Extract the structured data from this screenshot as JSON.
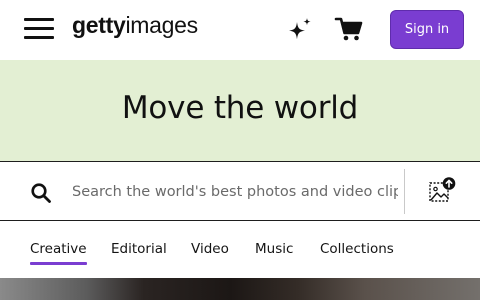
{
  "header": {
    "logo_bold": "getty",
    "logo_light": "images",
    "menu_icon": "hamburger-menu-icon",
    "ai_icon": "sparkle-icon",
    "cart_icon": "shopping-cart-icon",
    "sign_in_label": "Sign in",
    "accent_color": "#7a3dd1"
  },
  "hero": {
    "title": "Move the world",
    "background_color": "#e3efd3"
  },
  "search": {
    "icon": "search-icon",
    "placeholder": "Search the world's best photos and video clips",
    "value": "",
    "image_search_icon": "image-upload-icon"
  },
  "tabs": [
    {
      "label": "Creative",
      "active": true
    },
    {
      "label": "Editorial",
      "active": false
    },
    {
      "label": "Video",
      "active": false
    },
    {
      "label": "Music",
      "active": false
    },
    {
      "label": "Collections",
      "active": false
    }
  ]
}
